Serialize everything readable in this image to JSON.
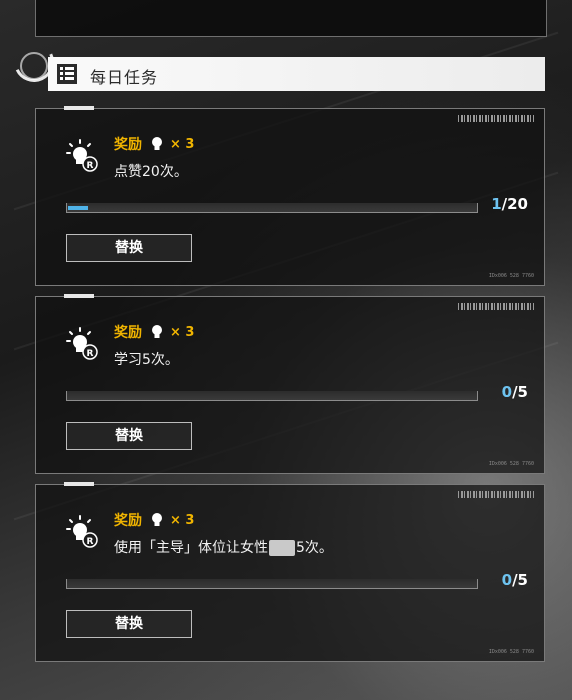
{
  "header": {
    "title": "每日任务"
  },
  "tasks": [
    {
      "reward_label": "奖励",
      "reward_multiplier": "× 3",
      "description": "点赞20次。",
      "progress_current": "1",
      "progress_total": "/20",
      "progress_fraction": 0.05,
      "button_label": "替换",
      "code": "IDx006 528 7760"
    },
    {
      "reward_label": "奖励",
      "reward_multiplier": "× 3",
      "description": "学习5次。",
      "progress_current": "0",
      "progress_total": "/5",
      "progress_fraction": 0,
      "button_label": "替换",
      "code": "IDx006 528 7760"
    },
    {
      "reward_label": "奖励",
      "reward_multiplier": "× 3",
      "description_before": "使用「主导」体位让女性",
      "description_after": "5次。",
      "progress_current": "0",
      "progress_total": "/5",
      "progress_fraction": 0,
      "button_label": "替换",
      "code": "IDx006 528 7760"
    }
  ],
  "colors": {
    "accent_gold": "#f0b400",
    "progress_blue": "#4fb3e8"
  },
  "icons": {
    "header": "list-icon",
    "task": "lightbulb-icon",
    "reward": "lightbulb-icon"
  }
}
